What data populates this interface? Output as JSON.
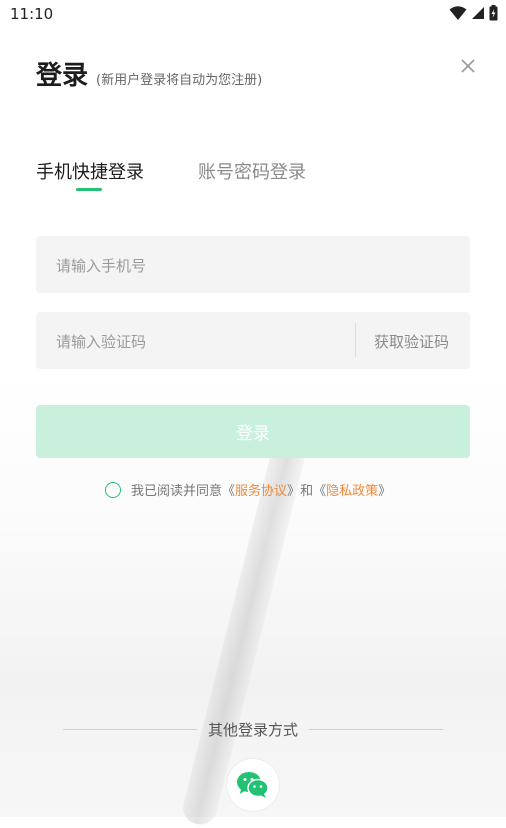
{
  "status_bar": {
    "time": "11:10"
  },
  "header": {
    "title": "登录",
    "subtitle": "(新用户登录将自动为您注册)"
  },
  "tabs": [
    {
      "label": "手机快捷登录",
      "active": true
    },
    {
      "label": "账号密码登录",
      "active": false
    }
  ],
  "form": {
    "phone_placeholder": "请输入手机号",
    "code_placeholder": "请输入验证码",
    "get_code_label": "获取验证码",
    "login_label": "登录"
  },
  "agreement": {
    "prefix": "我已阅读并同意",
    "open_quote_1": "《",
    "service_link": "服务协议",
    "close_quote_1": "》",
    "and": "和",
    "open_quote_2": "《",
    "privacy_link": "隐私政策",
    "close_quote_2": "》"
  },
  "other_login": {
    "label": "其他登录方式"
  },
  "colors": {
    "accent": "#22c173",
    "login_button_disabled": "#c9efdd",
    "link": "#f0893a",
    "field_bg": "#f4f4f4"
  },
  "icons": {
    "close": "close-icon",
    "wechat": "wechat-icon",
    "wifi": "wifi-icon",
    "signal": "signal-icon",
    "battery": "battery-icon"
  }
}
